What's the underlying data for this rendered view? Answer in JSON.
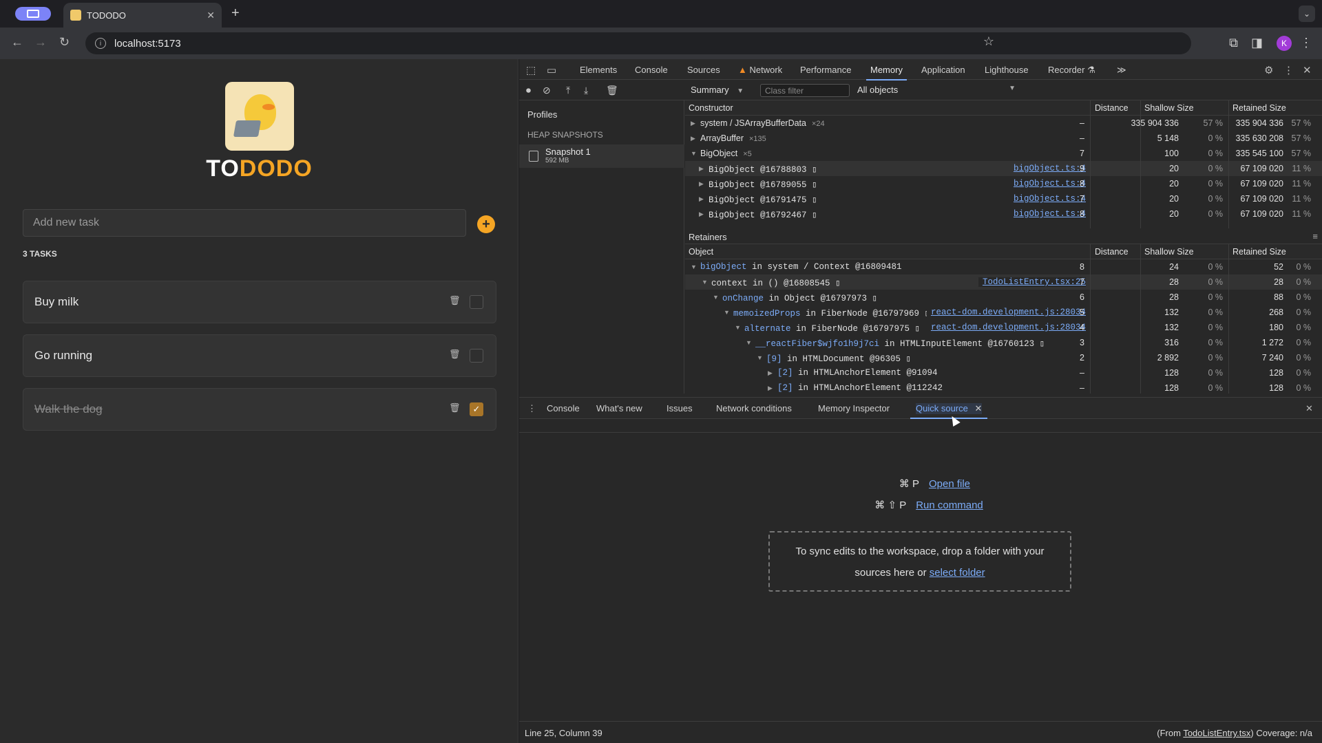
{
  "browser": {
    "tab_title": "TODODO",
    "tab_close": "✕",
    "new_tab": "+",
    "url": "localhost:5173",
    "tab_menu": "⌄",
    "avatar_letter": "K"
  },
  "app": {
    "brand_to": "TO",
    "brand_dodo": "DODO",
    "add_placeholder": "Add new task",
    "add_button": "+",
    "task_count": "3 TASKS",
    "tasks": [
      {
        "title": "Buy milk",
        "done": false
      },
      {
        "title": "Go running",
        "done": false
      },
      {
        "title": "Walk the dog",
        "done": true
      }
    ],
    "check_mark": "✓",
    "trash": "🗑"
  },
  "devtools": {
    "tabs": [
      "Elements",
      "Console",
      "Sources",
      "Network",
      "Performance",
      "Memory",
      "Application",
      "Lighthouse",
      "Recorder",
      "≫"
    ],
    "active_tab": "Memory",
    "summary_select": "Summary",
    "class_filter_placeholder": "Class filter",
    "objects_select": "All objects",
    "sidebar": {
      "profiles": "Profiles",
      "heap_snapshots": "HEAP SNAPSHOTS",
      "snapshot_name": "Snapshot 1",
      "snapshot_size": "592 MB"
    },
    "constructor_headers": [
      "Constructor",
      "Distance",
      "Shallow Size",
      "Retained Size"
    ],
    "constructor_rows": [
      {
        "arrow": "▶",
        "name": "system / JSArrayBufferData",
        "count": "×24",
        "link": "",
        "dist": "–",
        "shallow": "335 904 336",
        "shallow_pct": "57 %",
        "retained": "335 904 336",
        "retained_pct": "57 %"
      },
      {
        "arrow": "▶",
        "name": "ArrayBuffer",
        "count": "×135",
        "link": "",
        "dist": "–",
        "shallow": "5 148",
        "shallow_pct": "0 %",
        "retained": "335 630 208",
        "retained_pct": "57 %"
      },
      {
        "arrow": "▼",
        "name": "BigObject",
        "count": "×5",
        "link": "",
        "dist": "7",
        "shallow": "100",
        "shallow_pct": "0 %",
        "retained": "335 545 100",
        "retained_pct": "57 %"
      },
      {
        "arrow": "▶",
        "name": "BigObject @16788803 ▯",
        "count": "",
        "link": "bigObject.ts:4",
        "dist": "9",
        "shallow": "20",
        "shallow_pct": "0 %",
        "retained": "67 109 020",
        "retained_pct": "11 %"
      },
      {
        "arrow": "▶",
        "name": "BigObject @16789055 ▯",
        "count": "",
        "link": "bigObject.ts:4",
        "dist": "8",
        "shallow": "20",
        "shallow_pct": "0 %",
        "retained": "67 109 020",
        "retained_pct": "11 %"
      },
      {
        "arrow": "▶",
        "name": "BigObject @16791475 ▯",
        "count": "",
        "link": "bigObject.ts:4",
        "dist": "7",
        "shallow": "20",
        "shallow_pct": "0 %",
        "retained": "67 109 020",
        "retained_pct": "11 %"
      },
      {
        "arrow": "▶",
        "name": "BigObject @16792467 ▯",
        "count": "",
        "link": "bigObject.ts:4",
        "dist": "8",
        "shallow": "20",
        "shallow_pct": "0 %",
        "retained": "67 109 020",
        "retained_pct": "11 %"
      }
    ],
    "retainers_label": "Retainers",
    "retainer_headers": [
      "Object",
      "Distance",
      "Shallow Size",
      "Retained Size"
    ],
    "retainer_rows": [
      {
        "arrow": "▼",
        "prop": "bigObject",
        "rest": " in system / Context @16809481",
        "link": "",
        "dist": "8",
        "shallow": "24",
        "shallow_pct": "0 %",
        "retained": "52",
        "retained_pct": "0 %"
      },
      {
        "arrow": "▼",
        "prop": "",
        "rest": "context in () @16808545 ▯",
        "link": "TodoListEntry.tsx:25",
        "dist": "7",
        "shallow": "28",
        "shallow_pct": "0 %",
        "retained": "28",
        "retained_pct": "0 %"
      },
      {
        "arrow": "▼",
        "prop": "onChange",
        "rest": " in Object @16797973 ▯",
        "link": "",
        "dist": "6",
        "shallow": "28",
        "shallow_pct": "0 %",
        "retained": "88",
        "retained_pct": "0 %"
      },
      {
        "arrow": "▼",
        "prop": "memoizedProps",
        "rest": " in FiberNode @16797969 ▯",
        "link": "react-dom.development.js:28034",
        "dist": "5",
        "shallow": "132",
        "shallow_pct": "0 %",
        "retained": "268",
        "retained_pct": "0 %"
      },
      {
        "arrow": "▼",
        "prop": "alternate",
        "rest": " in FiberNode @16797975 ▯",
        "link": "react-dom.development.js:28034",
        "dist": "4",
        "shallow": "132",
        "shallow_pct": "0 %",
        "retained": "180",
        "retained_pct": "0 %"
      },
      {
        "arrow": "▼",
        "prop": "__reactFiber$wjfo1h9j7ci",
        "rest": " in HTMLInputElement @16760123 ▯",
        "link": "",
        "dist": "3",
        "shallow": "316",
        "shallow_pct": "0 %",
        "retained": "1 272",
        "retained_pct": "0 %"
      },
      {
        "arrow": "▼",
        "prop": "[9]",
        "rest": " in HTMLDocument @96305 ▯",
        "link": "",
        "dist": "2",
        "shallow": "2 892",
        "shallow_pct": "0 %",
        "retained": "7 240",
        "retained_pct": "0 %"
      },
      {
        "arrow": "▶",
        "prop": "[2]",
        "rest": " in HTMLAnchorElement @91094",
        "link": "",
        "dist": "–",
        "shallow": "128",
        "shallow_pct": "0 %",
        "retained": "128",
        "retained_pct": "0 %"
      },
      {
        "arrow": "▶",
        "prop": "[2]",
        "rest": " in HTMLAnchorElement @112242",
        "link": "",
        "dist": "–",
        "shallow": "128",
        "shallow_pct": "0 %",
        "retained": "128",
        "retained_pct": "0 %"
      }
    ],
    "drawer_tabs": [
      "Console",
      "What's new",
      "Issues",
      "Network conditions",
      "Memory Inspector",
      "Quick source"
    ],
    "drawer_active": "Quick source",
    "quick_source": {
      "open_keys": "⌘ P",
      "open_label": "Open file",
      "run_keys": "⌘ ⇧ P",
      "run_label": "Run command",
      "drop_text_1": "To sync edits to the workspace, drop a folder with your",
      "drop_text_2": "sources here or",
      "select_folder": "select folder"
    },
    "status_left": "Line 25, Column 39",
    "status_from_prefix": "(From",
    "status_from_file": "TodoListEntry.tsx",
    "status_from_suffix": ")",
    "status_coverage": "Coverage: n/a"
  },
  "colors": {
    "accent": "#f5a524",
    "devtools_link": "#7cacf8",
    "warning": "#f08a24"
  }
}
